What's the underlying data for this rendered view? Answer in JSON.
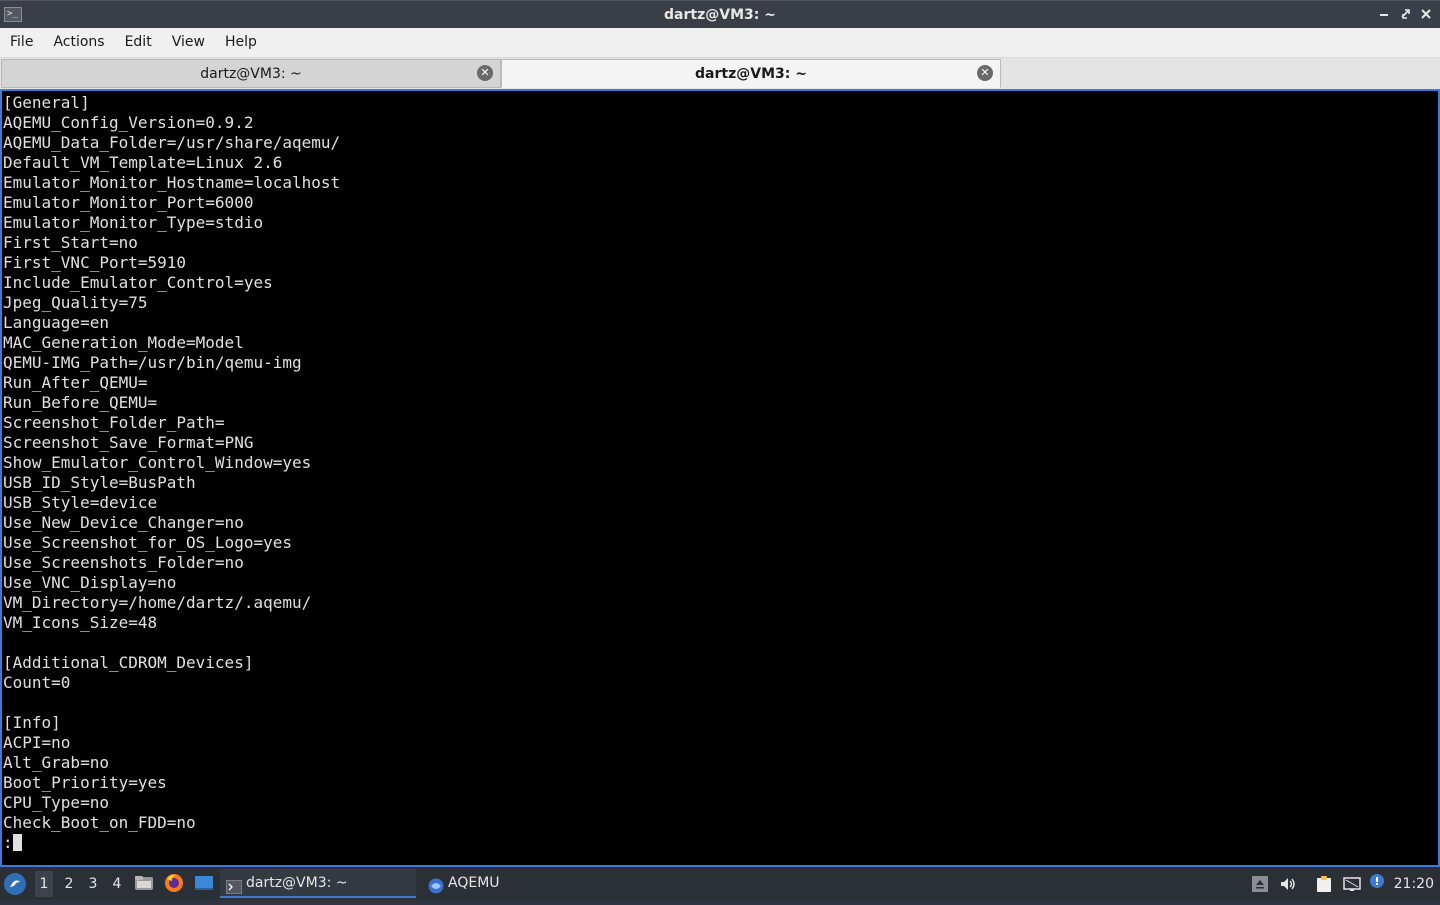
{
  "window": {
    "title": "dartz@VM3: ~",
    "controls": [
      "minimize-icon",
      "maximize-icon",
      "close-icon"
    ]
  },
  "menubar": {
    "items": [
      "File",
      "Actions",
      "Edit",
      "View",
      "Help"
    ]
  },
  "tabs": [
    {
      "label": "dartz@VM3: ~",
      "active": false
    },
    {
      "label": "dartz@VM3: ~",
      "active": true
    }
  ],
  "terminal": {
    "lines": [
      "[General]",
      "AQEMU_Config_Version=0.9.2",
      "AQEMU_Data_Folder=/usr/share/aqemu/",
      "Default_VM_Template=Linux 2.6",
      "Emulator_Monitor_Hostname=localhost",
      "Emulator_Monitor_Port=6000",
      "Emulator_Monitor_Type=stdio",
      "First_Start=no",
      "First_VNC_Port=5910",
      "Include_Emulator_Control=yes",
      "Jpeg_Quality=75",
      "Language=en",
      "MAC_Generation_Mode=Model",
      "QEMU-IMG_Path=/usr/bin/qemu-img",
      "Run_After_QEMU=",
      "Run_Before_QEMU=",
      "Screenshot_Folder_Path=",
      "Screenshot_Save_Format=PNG",
      "Show_Emulator_Control_Window=yes",
      "USB_ID_Style=BusPath",
      "USB_Style=device",
      "Use_New_Device_Changer=no",
      "Use_Screenshot_for_OS_Logo=yes",
      "Use_Screenshots_Folder=no",
      "Use_VNC_Display=no",
      "VM_Directory=/home/dartz/.aqemu/",
      "VM_Icons_Size=48",
      "",
      "[Additional_CDROM_Devices]",
      "Count=0",
      "",
      "[Info]",
      "ACPI=no",
      "Alt_Grab=no",
      "Boot_Priority=yes",
      "CPU_Type=no",
      "Check_Boot_on_FDD=no"
    ],
    "prompt": ":"
  },
  "taskbar": {
    "workspaces": [
      "1",
      "2",
      "3",
      "4"
    ],
    "active_workspace": "1",
    "quicklaunch": [
      "file-manager-icon",
      "firefox-icon",
      "desktop-icon"
    ],
    "tasks": [
      {
        "label": "dartz@VM3: ~",
        "icon": "terminal-icon",
        "active": true
      },
      {
        "label": "AQEMU",
        "icon": "aqemu-icon",
        "active": false
      }
    ],
    "tray": [
      "eject-icon",
      "volume-icon",
      "clipboard-icon",
      "network-icon",
      "notification-icon"
    ],
    "clock": "21:20"
  },
  "colors": {
    "terminal_bg": "#000000",
    "terminal_fg": "#e0e0e0",
    "accent": "#3a7bd5",
    "titlebar": "#3a3f47",
    "taskbar": "#2b2f36"
  }
}
